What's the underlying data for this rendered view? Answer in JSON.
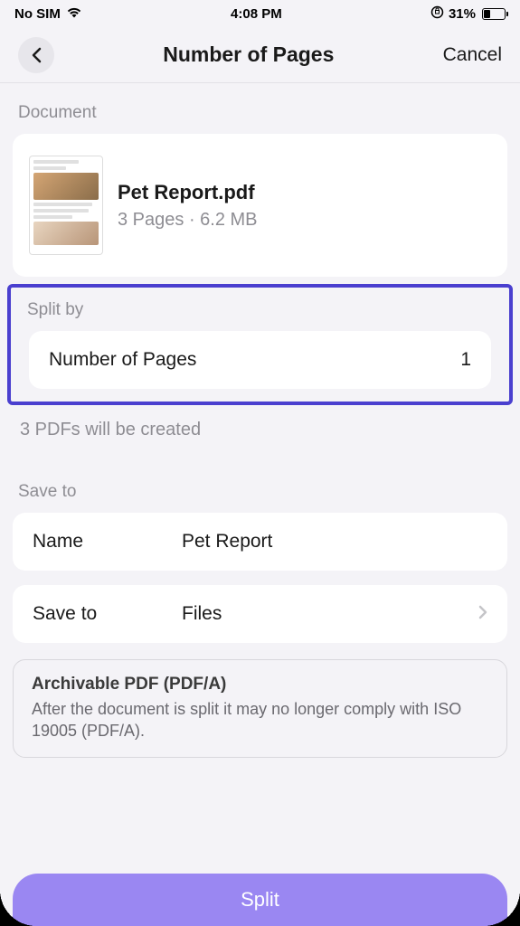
{
  "status": {
    "carrier": "No SIM",
    "time": "4:08 PM",
    "battery_pct": "31%"
  },
  "nav": {
    "title": "Number of Pages",
    "cancel": "Cancel"
  },
  "document": {
    "section_label": "Document",
    "name": "Pet Report.pdf",
    "meta": "3 Pages · 6.2 MB"
  },
  "split": {
    "section_label": "Split by",
    "label": "Number of Pages",
    "value": "1",
    "result": "3 PDFs will be created"
  },
  "save": {
    "section_label": "Save to",
    "name_label": "Name",
    "name_value": "Pet Report",
    "saveto_label": "Save to",
    "saveto_value": "Files"
  },
  "info": {
    "title": "Archivable PDF (PDF/A)",
    "body": "After the document is split it may no longer comply with ISO 19005 (PDF/A)."
  },
  "action": {
    "split": "Split"
  }
}
